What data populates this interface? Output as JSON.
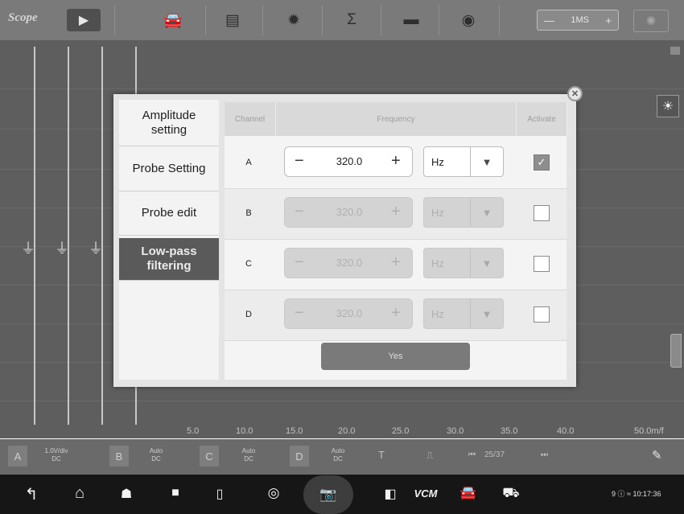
{
  "app": {
    "logo": "Scope"
  },
  "toolbar": {
    "icons": [
      "play-icon",
      "car-icon",
      "report-icon",
      "gear-icon",
      "sigma-icon",
      "folder-icon",
      "globe-icon"
    ],
    "time_minus": "—",
    "time_value": "1MS",
    "time_plus": "+"
  },
  "dialog": {
    "menu": [
      {
        "label": "Amplitude setting",
        "selected": false
      },
      {
        "label": "Probe Setting",
        "selected": false
      },
      {
        "label": "Probe edit",
        "selected": false
      },
      {
        "label": "Low-pass filtering",
        "selected": true
      }
    ],
    "headers": {
      "channel": "Channel",
      "frequency": "Frequency",
      "activate": "Activate"
    },
    "rows": [
      {
        "channel": "A",
        "value": "320.0",
        "unit": "Hz",
        "enabled": true,
        "active": true
      },
      {
        "channel": "B",
        "value": "320.0",
        "unit": "Hz",
        "enabled": false,
        "active": false
      },
      {
        "channel": "C",
        "value": "320.0",
        "unit": "Hz",
        "enabled": false,
        "active": false
      },
      {
        "channel": "D",
        "value": "320.0",
        "unit": "Hz",
        "enabled": false,
        "active": false
      }
    ],
    "minus": "−",
    "plus": "+",
    "yes": "Yes"
  },
  "plot": {
    "x_ticks": [
      "5.0",
      "10.0",
      "15.0",
      "20.0",
      "25.0",
      "30.0",
      "35.0",
      "40.0",
      "50.0m/f"
    ]
  },
  "channel_bar": {
    "a_label": "A",
    "a_scale": "1.0V/div",
    "a_mode": "DC",
    "b_label": "B",
    "auto": "Auto",
    "dc": "DC",
    "c_label": "C",
    "d_label": "D",
    "page": "25/37"
  },
  "navbar": {
    "vcm": "VCM",
    "status": "9 ⓘ ≈ 10:17:36"
  }
}
